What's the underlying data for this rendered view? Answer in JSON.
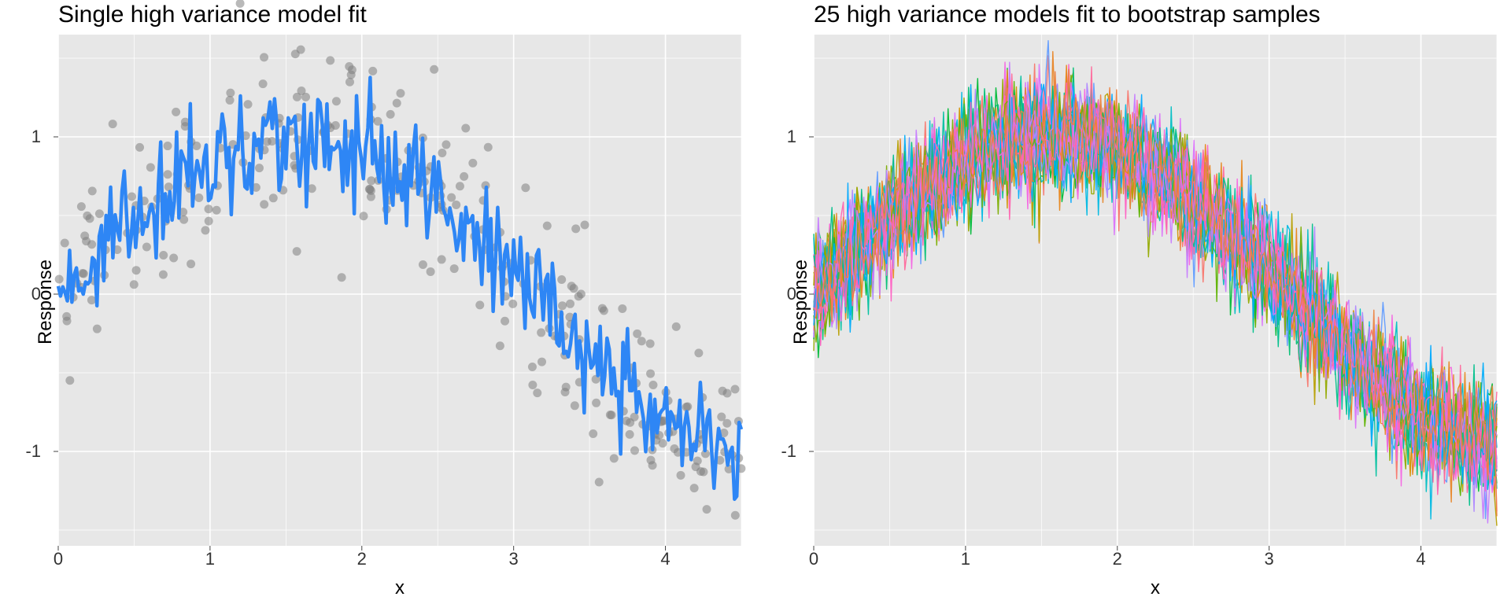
{
  "chart_data": [
    {
      "type": "scatter+line",
      "title": "Single high variance model fit",
      "xlabel": "x",
      "ylabel": "Response",
      "xlim": [
        0,
        4.5
      ],
      "ylim": [
        -1.6,
        1.65
      ],
      "x_ticks": [
        0,
        1,
        2,
        3,
        4
      ],
      "y_ticks": [
        -1,
        0,
        1
      ],
      "description": "~300 scatter points from y = sin(x) + N(0,0.3) over x in [0,4.5], plus a high-variance fitted curve in blue approximating sin(x) with additive noise of sd~0.18.",
      "scatter": {
        "n": 300,
        "mean_curve": "sin(x)",
        "noise_sd": 0.3,
        "color": "#808080",
        "alpha": 0.55
      },
      "fit_line": {
        "color": "#2E86F5",
        "mean_curve": "sin(x)",
        "noise_sd": 0.18,
        "step": 0.015
      }
    },
    {
      "type": "multi-line",
      "title": "25 high variance models fit to bootstrap samples",
      "xlabel": "x",
      "ylabel": "Response",
      "xlim": [
        0,
        4.5
      ],
      "ylim": [
        -1.6,
        1.65
      ],
      "x_ticks": [
        0,
        1,
        2,
        3,
        4
      ],
      "y_ticks": [
        -1,
        0,
        1
      ],
      "n_lines": 25,
      "line_description": "25 high-variance fits, each ≈ sin(x) + independent noise sd~0.18, drawn in distinct hues.",
      "line_spec": {
        "mean_curve": "sin(x)",
        "noise_sd": 0.18,
        "step": 0.015
      },
      "palette": [
        "#F8766D",
        "#E88526",
        "#D39200",
        "#B79F00",
        "#93AA00",
        "#5EB300",
        "#00BA38",
        "#00BF74",
        "#00C19F",
        "#00BFC4",
        "#00B9E3",
        "#00ADFA",
        "#619CFF",
        "#AE87FF",
        "#DB72FB",
        "#F564E3",
        "#FF61C3",
        "#FF699C",
        "#E7861B",
        "#7CAE00",
        "#00C08B",
        "#00A9FF",
        "#C77CFF",
        "#FF64B0",
        "#ED813E"
      ]
    }
  ],
  "left": {
    "title": "Single high variance model fit",
    "xlabel": "x",
    "ylabel": "Response",
    "xticks": [
      "0",
      "1",
      "2",
      "3",
      "4"
    ],
    "yticks": [
      "-1",
      "0",
      "1"
    ]
  },
  "right": {
    "title": "25 high variance models fit to bootstrap samples",
    "xlabel": "x",
    "ylabel": "Response",
    "xticks": [
      "0",
      "1",
      "2",
      "3",
      "4"
    ],
    "yticks": [
      "-1",
      "0",
      "1"
    ]
  }
}
